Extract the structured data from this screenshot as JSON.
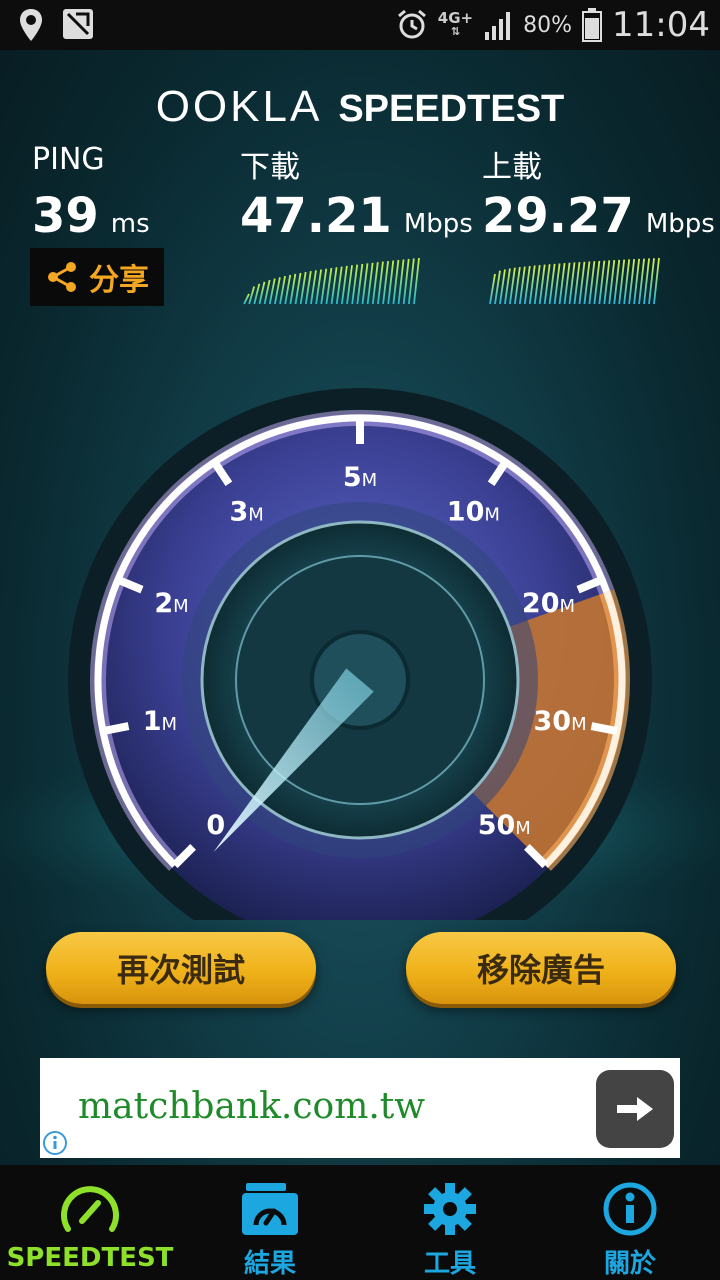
{
  "status_bar": {
    "network": "4G+",
    "battery": "80%",
    "time": "11:04",
    "icons": [
      "location-icon",
      "no-sim-icon",
      "alarm-icon",
      "signal-icon",
      "battery-icon"
    ]
  },
  "brand": {
    "logo": "OOKLA",
    "product": "SPEEDTEST"
  },
  "ping": {
    "label": "PING",
    "value": "39",
    "unit": "ms"
  },
  "download": {
    "label": "下載",
    "value": "47.21",
    "unit": "Mbps"
  },
  "upload": {
    "label": "上載",
    "value": "29.27",
    "unit": "Mbps"
  },
  "share": {
    "label": "分享",
    "icon": "share-icon"
  },
  "gauge": {
    "ticks": [
      {
        "num": "0",
        "unit": ""
      },
      {
        "num": "1",
        "unit": "M"
      },
      {
        "num": "2",
        "unit": "M"
      },
      {
        "num": "3",
        "unit": "M"
      },
      {
        "num": "5",
        "unit": "M"
      },
      {
        "num": "10",
        "unit": "M"
      },
      {
        "num": "20",
        "unit": "M"
      },
      {
        "num": "30",
        "unit": "M"
      },
      {
        "num": "50",
        "unit": "M"
      }
    ]
  },
  "buttons": {
    "retest": "再次測試",
    "remove_ads": "移除廣告"
  },
  "ad": {
    "text": "matchbank.com.tw"
  },
  "nav": [
    {
      "label": "SPEEDTEST",
      "icon": "speedometer-icon",
      "active": true
    },
    {
      "label": "結果",
      "icon": "results-folder-icon",
      "active": false
    },
    {
      "label": "工具",
      "icon": "gear-icon",
      "active": false
    },
    {
      "label": "關於",
      "icon": "info-icon",
      "active": false
    }
  ],
  "colors": {
    "accent_orange": "#f5a623",
    "nav_blue": "#1ca7e0",
    "nav_active": "#8ee02b",
    "ad_green": "#1f8a2a"
  }
}
